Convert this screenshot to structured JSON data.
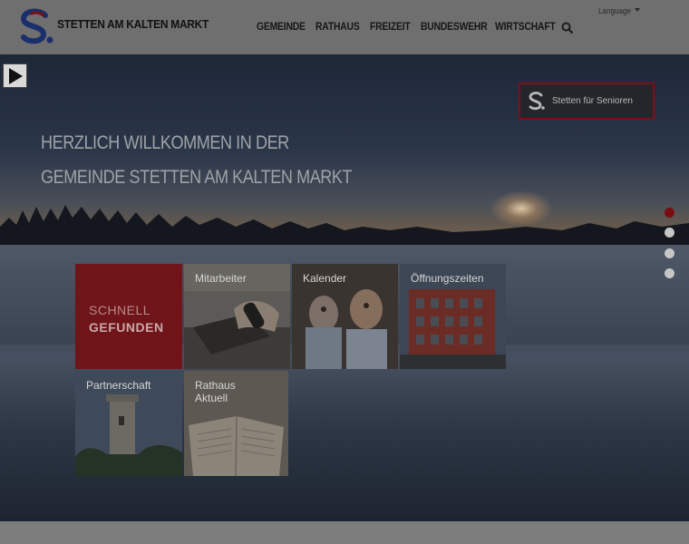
{
  "header": {
    "site_title": "STETTEN AM KALTEN MARKT",
    "nav": [
      "GEMEINDE",
      "RATHAUS",
      "FREIZEIT",
      "BUNDESWEHR",
      "WIRTSCHAFT"
    ],
    "language_label": "Language"
  },
  "hero": {
    "title_line1": "HERZLICH WILLKOMMEN IN DER",
    "title_line2": "GEMEINDE STETTEN AM KALTEN MARKT",
    "senior_button_label": "Stetten für Senioren",
    "slide_count": 4,
    "active_slide": 1
  },
  "quick": {
    "line1": "SCHNELL",
    "line2": "GEFUNDEN"
  },
  "tiles": [
    {
      "label": "Mitarbeiter"
    },
    {
      "label": "Kalender"
    },
    {
      "label": "Öffnungszeiten"
    },
    {
      "label": "Partnerschaft"
    },
    {
      "label": "Rathaus Aktuell"
    }
  ],
  "colors": {
    "brand_red": "#7a0d12",
    "brand_blue": "#1a2f6b"
  }
}
